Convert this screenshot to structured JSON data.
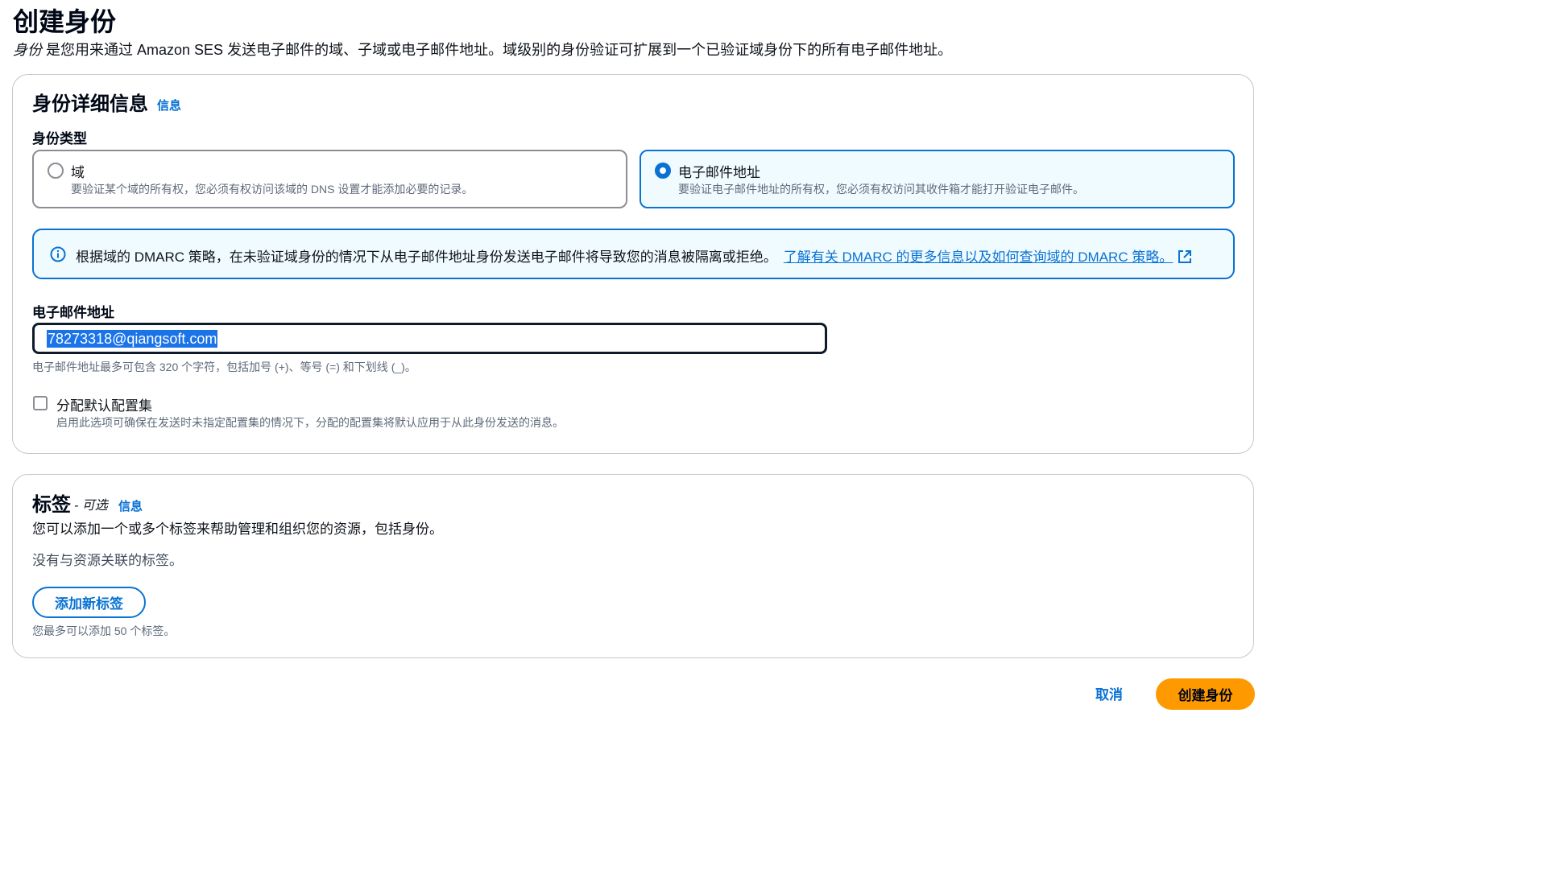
{
  "page": {
    "title": "创建身份",
    "description_em": "身份",
    "description_rest": "是您用来通过 Amazon SES 发送电子邮件的域、子域或电子邮件地址。域级别的身份验证可扩展到一个已验证域身份下的所有电子邮件地址。"
  },
  "details": {
    "heading": "身份详细信息",
    "info_link": "信息",
    "identity_type_label": "身份类型",
    "options": [
      {
        "title": "域",
        "description": "要验证某个域的所有权，您必须有权访问该域的 DNS 设置才能添加必要的记录。",
        "selected": false
      },
      {
        "title": "电子邮件地址",
        "description": "要验证电子邮件地址的所有权，您必须有权访问其收件箱才能打开验证电子邮件。",
        "selected": true
      }
    ],
    "alert": {
      "icon": "info-circle-icon",
      "text": "根据域的 DMARC 策略，在未验证域身份的情况下从电子邮件地址身份发送电子邮件将导致您的消息被隔离或拒绝。",
      "link_text": "了解有关 DMARC 的更多信息以及如何查询域的 DMARC 策略。",
      "link_icon": "external-link-icon"
    },
    "email_label": "电子邮件地址",
    "email_value": "78273318@qiangsoft.com",
    "email_hint": "电子邮件地址最多可包含 320 个字符，包括加号 (+)、等号 (=) 和下划线 (_)。",
    "default_config": {
      "label": "分配默认配置集",
      "description": "启用此选项可确保在发送时未指定配置集的情况下，分配的配置集将默认应用于从此身份发送的消息。",
      "checked": false
    }
  },
  "tags": {
    "heading": "标签",
    "optional": "- 可选",
    "info_link": "信息",
    "description": "您可以添加一个或多个标签来帮助管理和组织您的资源，包括身份。",
    "empty_text": "没有与资源关联的标签。",
    "add_button": "添加新标签",
    "limit_hint": "您最多可以添加 50 个标签。"
  },
  "footer": {
    "cancel": "取消",
    "submit": "创建身份"
  },
  "colors": {
    "accent": "#0972d3",
    "primary_button": "#ff9900",
    "alert_bg": "#f0fbff"
  }
}
